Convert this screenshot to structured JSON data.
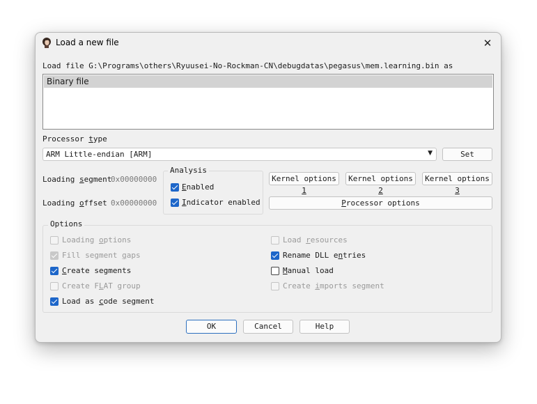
{
  "window": {
    "title": "Load a new file",
    "app_icon": "avatar-icon",
    "close_icon": "close-icon"
  },
  "load_file_label": "Load file G:\\Programs\\others\\Ryuusei-No-Rockman-CN\\debugdatas\\pegasus\\mem.learning.bin as",
  "file_types": [
    "Binary file"
  ],
  "processor_type": {
    "label": "Processor type",
    "value": "ARM Little-endian [ARM]",
    "set_button": "Set"
  },
  "loading": {
    "segment_label": "Loading segment",
    "segment_value": "0x00000000",
    "offset_label": "Loading offset",
    "offset_value": "0x00000000"
  },
  "analysis": {
    "title": "Analysis",
    "enabled": {
      "label": "Enabled",
      "checked": true
    },
    "indicator": {
      "label": "Indicator enabled",
      "checked": true
    }
  },
  "kernel_options": {
    "k1": "Kernel options 1",
    "k2": "Kernel options 2",
    "k3": "Kernel options 3"
  },
  "processor_options": "Processor options",
  "options": {
    "title": "Options",
    "loading_options": {
      "label": "Loading options",
      "checked": false,
      "disabled": true
    },
    "fill_segment_gaps": {
      "label": "Fill segment gaps",
      "checked": true,
      "disabled": true
    },
    "create_segments": {
      "label": "Create segments",
      "checked": true,
      "disabled": false
    },
    "create_flat_group": {
      "label": "Create FLAT group",
      "checked": false,
      "disabled": true
    },
    "load_as_code": {
      "label": "Load as code segment",
      "checked": true,
      "disabled": false
    },
    "load_resources": {
      "label": "Load resources",
      "checked": false,
      "disabled": true
    },
    "rename_dll": {
      "label": "Rename DLL entries",
      "checked": true,
      "disabled": false
    },
    "manual_load": {
      "label": "Manual load",
      "checked": false,
      "disabled": false
    },
    "create_imports": {
      "label": "Create imports segment",
      "checked": false,
      "disabled": true
    }
  },
  "buttons": {
    "ok": "OK",
    "cancel": "Cancel",
    "help": "Help"
  },
  "colors": {
    "accent": "#1d66c9",
    "dialog_bg": "#f0f0f0",
    "default_border": "#2c6fbf"
  }
}
